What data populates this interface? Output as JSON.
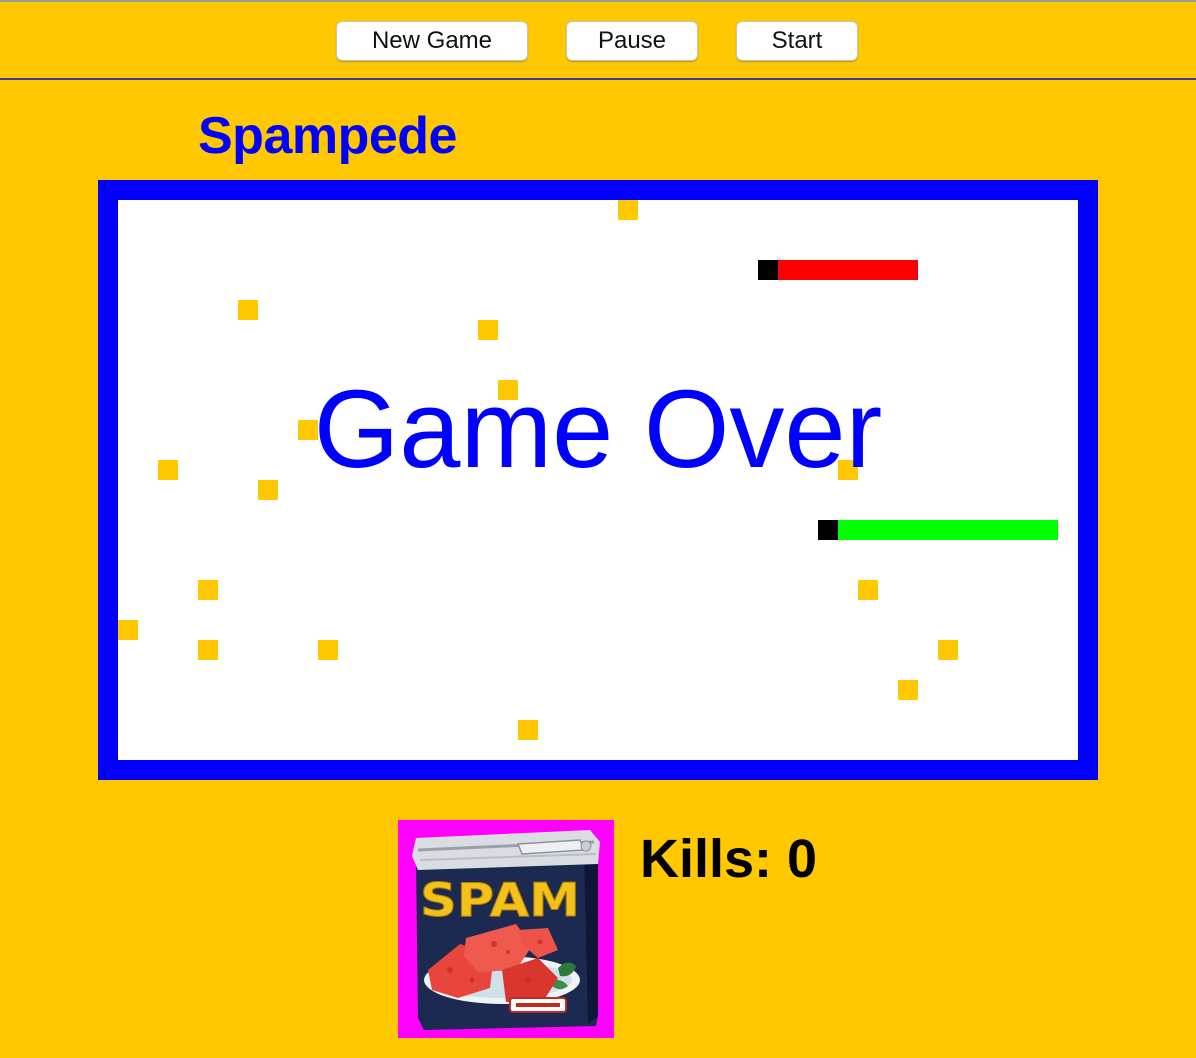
{
  "controls": {
    "new_game_label": "New Game",
    "pause_label": "Pause",
    "start_label": "Start"
  },
  "game": {
    "title": "Spampede",
    "message": "Game Over",
    "kills_label": "Kills:",
    "kills_value": 0,
    "kills_text": "Kills: 0",
    "spam_can_label": "SPAM",
    "grid": {
      "columns": 48,
      "rows": 28
    },
    "spam_cells": [
      [
        25,
        0
      ],
      [
        6,
        5
      ],
      [
        18,
        6
      ],
      [
        19,
        9
      ],
      [
        9,
        11
      ],
      [
        2,
        13
      ],
      [
        7,
        14
      ],
      [
        36,
        13
      ],
      [
        4,
        19
      ],
      [
        37,
        19
      ],
      [
        0,
        21
      ],
      [
        4,
        22
      ],
      [
        10,
        22
      ],
      [
        41,
        22
      ],
      [
        39,
        24
      ],
      [
        20,
        26
      ]
    ],
    "snakes": [
      {
        "name": "red",
        "head": [
          32,
          3
        ],
        "body": [
          [
            33,
            3
          ],
          [
            34,
            3
          ],
          [
            35,
            3
          ],
          [
            36,
            3
          ],
          [
            37,
            3
          ],
          [
            38,
            3
          ],
          [
            39,
            3
          ]
        ]
      },
      {
        "name": "green",
        "head": [
          35,
          16
        ],
        "body": [
          [
            36,
            16
          ],
          [
            37,
            16
          ],
          [
            38,
            16
          ],
          [
            39,
            16
          ],
          [
            40,
            16
          ],
          [
            41,
            16
          ],
          [
            42,
            16
          ],
          [
            43,
            16
          ],
          [
            44,
            16
          ],
          [
            45,
            16
          ],
          [
            46,
            16
          ]
        ]
      }
    ]
  },
  "colors": {
    "background": "#FFC800",
    "wall": "#0000FF",
    "field": "#FFFFFF",
    "spam": "#FFC800",
    "snake_head": "#000000",
    "snake_red": "#FF0000",
    "snake_green": "#00FF00",
    "text_blue": "#0000FF",
    "spam_frame": "#FF00FF"
  }
}
